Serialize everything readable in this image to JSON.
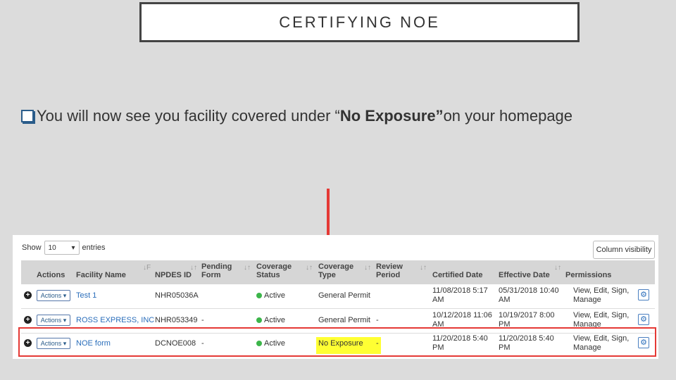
{
  "slide": {
    "title": "CERTIFYING NOE",
    "bullet_text_pre": "You will now see you facility covered under “",
    "bullet_text_bold": "No Exposure”",
    "bullet_text_post": " on your homepage"
  },
  "table_ui": {
    "show_label": "Show",
    "entries_value": "10",
    "entries_label": "entries",
    "column_visibility_label": "Column visibility",
    "headers": {
      "actions": "Actions",
      "facility_name": "Facility Name",
      "npdes_id": "NPDES ID",
      "pending_form_1": "Pending",
      "pending_form_2": "Form",
      "coverage_status_1": "Coverage",
      "coverage_status_2": "Status",
      "coverage_type_1": "Coverage",
      "coverage_type_2": "Type",
      "review_period_1": "Review",
      "review_period_2": "Period",
      "certified_date": "Certified Date",
      "effective_date": "Effective Date",
      "permissions": "Permissions"
    },
    "rows": [
      {
        "actions_label": "Actions",
        "facility_name": "Test 1",
        "npdes_id": "NHR05036A",
        "pending_form": "",
        "coverage_status": "Active",
        "coverage_type": "General Permit",
        "review_period": "",
        "certified_date_1": "11/08/2018 5:17",
        "certified_date_2": "AM",
        "effective_date_1": "05/31/2018 10:40",
        "effective_date_2": "AM",
        "permissions_1": "View, Edit, Sign,",
        "permissions_2": "Manage"
      },
      {
        "actions_label": "Actions",
        "facility_name": "ROSS EXPRESS, INC",
        "npdes_id": "NHR053349",
        "pending_form": "-",
        "coverage_status": "Active",
        "coverage_type": "General Permit",
        "review_period": "-",
        "certified_date_1": "10/12/2018 11:06",
        "certified_date_2": "AM",
        "effective_date_1": "10/19/2017 8:00",
        "effective_date_2": "PM",
        "permissions_1": "View, Edit, Sign,",
        "permissions_2": "Manage"
      },
      {
        "actions_label": "Actions",
        "facility_name": "NOE form",
        "npdes_id": "DCNOE008",
        "pending_form": "-",
        "coverage_status": "Active",
        "coverage_type": "No Exposure",
        "review_period": "-",
        "certified_date_1": "11/20/2018 5:40",
        "certified_date_2": "PM",
        "effective_date_1": "11/20/2018 5:40",
        "effective_date_2": "PM",
        "permissions_1": "View, Edit, Sign,",
        "permissions_2": "Manage"
      }
    ]
  },
  "colors": {
    "highlight": "#ffff33",
    "outline": "#e53935",
    "arrow": "#e53935",
    "active_dot": "#3cb54a"
  },
  "icons": [
    "checkbox-bullet-icon",
    "red-arrow-icon",
    "expand-plus-icon",
    "dropdown-caret-icon",
    "sort-icon",
    "gear-icon"
  ]
}
